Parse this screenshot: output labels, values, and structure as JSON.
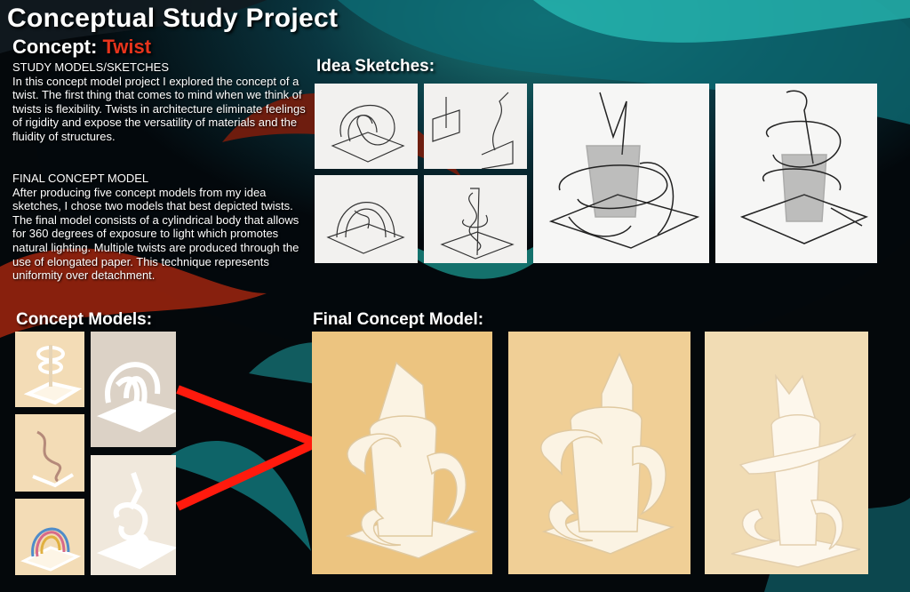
{
  "poster": {
    "title": "Conceptual Study Project",
    "concept_prefix": "Concept: ",
    "concept_word": "Twist",
    "accent_color": "#e8341c"
  },
  "study": {
    "heading": "STUDY MODELS/SKETCHES",
    "text": "In this concept model project I explored the concept of a twist. The first thing that comes to mind when we think of twists is flexibility. Twists in architecture eliminate feelings of rigidity and expose the versatility of materials and the fluidity of structures."
  },
  "final_text": {
    "heading": "FINAL CONCEPT MODEL",
    "text": "After producing five concept models from my idea sketches, I chose two models that best depicted twists. The final model consists of a cylindrical body that allows for 360 degrees of exposure to light which promotes natural lighting. Multiple twists are produced through the use of elongated paper. This technique represents uniformity over detachment."
  },
  "sections": {
    "idea_sketches": "Idea Sketches:",
    "concept_models": "Concept Models:",
    "final_concept_model": "Final Concept Model:"
  },
  "connector_color": "#ff1a0d"
}
